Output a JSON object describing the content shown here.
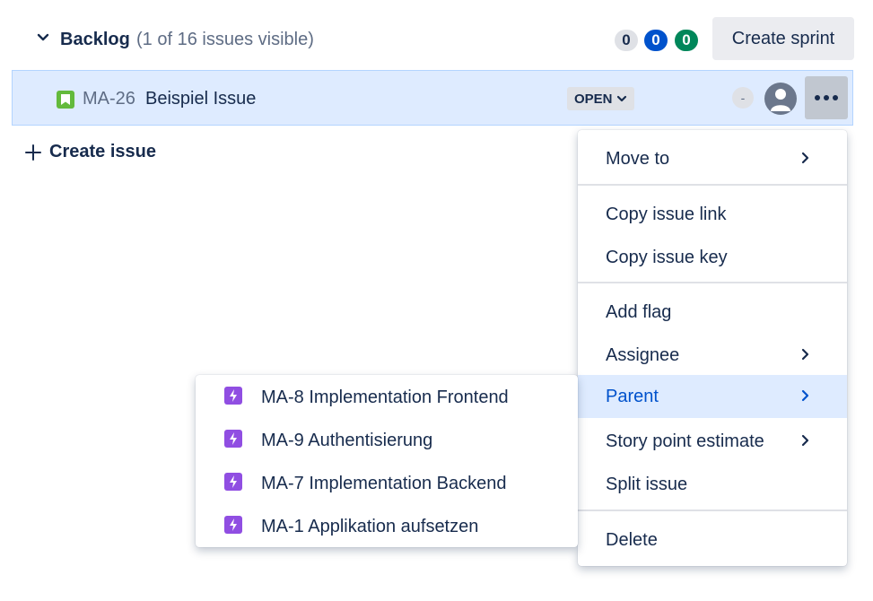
{
  "backlog": {
    "title": "Backlog",
    "visible_count": "(1 of 16 issues visible)",
    "badges": {
      "todo": "0",
      "in_progress": "0",
      "done": "0"
    },
    "create_sprint_label": "Create sprint"
  },
  "issue": {
    "key": "MA-26",
    "summary": "Beispiel Issue",
    "status": "OPEN",
    "estimate": "-",
    "type_icon": "story-icon"
  },
  "create_issue_label": "Create issue",
  "context_menu": {
    "items": [
      {
        "label": "Move to",
        "has_submenu": true
      },
      {
        "label": "Copy issue link",
        "has_submenu": false
      },
      {
        "label": "Copy issue key",
        "has_submenu": false
      },
      {
        "label": "Add flag",
        "has_submenu": false
      },
      {
        "label": "Assignee",
        "has_submenu": true
      },
      {
        "label": "Parent",
        "has_submenu": true,
        "selected": true
      },
      {
        "label": "Story point estimate",
        "has_submenu": true
      },
      {
        "label": "Split issue",
        "has_submenu": false
      },
      {
        "label": "Delete",
        "has_submenu": false
      }
    ]
  },
  "parent_submenu": {
    "items": [
      {
        "label": "MA-8 Implementation Frontend",
        "icon": "epic-icon"
      },
      {
        "label": "MA-9 Authentisierung",
        "icon": "epic-icon"
      },
      {
        "label": "MA-7 Implementation Backend",
        "icon": "epic-icon"
      },
      {
        "label": "MA-1 Applikation aufsetzen",
        "icon": "epic-icon"
      }
    ]
  },
  "colors": {
    "selected_bg": "#deebff",
    "accent_blue": "#0052cc",
    "story_green": "#63ba3c",
    "epic_purple": "#904ee2",
    "done_green": "#00875a"
  }
}
